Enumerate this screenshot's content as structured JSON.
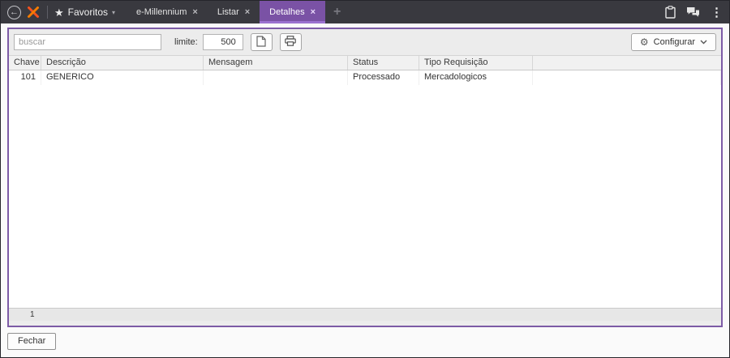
{
  "topbar": {
    "favorites_label": "Favoritos",
    "tabs": [
      {
        "label": "e-Millennium",
        "active": false
      },
      {
        "label": "Listar",
        "active": false
      },
      {
        "label": "Detalhes",
        "active": true
      }
    ]
  },
  "toolbar": {
    "search": {
      "placeholder": "buscar"
    },
    "limit": {
      "label": "limite:",
      "value": "500"
    },
    "configure": {
      "label": "Configurar"
    }
  },
  "grid": {
    "columns": [
      {
        "label": "Chave"
      },
      {
        "label": "Descrição"
      },
      {
        "label": "Mensagem"
      },
      {
        "label": "Status"
      },
      {
        "label": "Tipo Requisição"
      },
      {
        "label": ""
      }
    ],
    "rows": [
      {
        "cells": [
          "101",
          "GENERICO",
          "",
          "Processado",
          "Mercadologicos",
          ""
        ]
      }
    ],
    "record_count": "1"
  },
  "footer": {
    "close_label": "Fechar"
  },
  "icons": {
    "back_arrow": "←",
    "star": "★",
    "chevron_down": "▾",
    "close": "×",
    "add": "+",
    "kebab": "⋮",
    "gear": "⚙"
  },
  "colors": {
    "accent_purple": "#7d5ba6",
    "active_tab_purple": "#7a52a5",
    "active_tab_underline": "#9a71cf",
    "topbar_bg": "#39393f",
    "logo_orange": "#f4511e"
  }
}
